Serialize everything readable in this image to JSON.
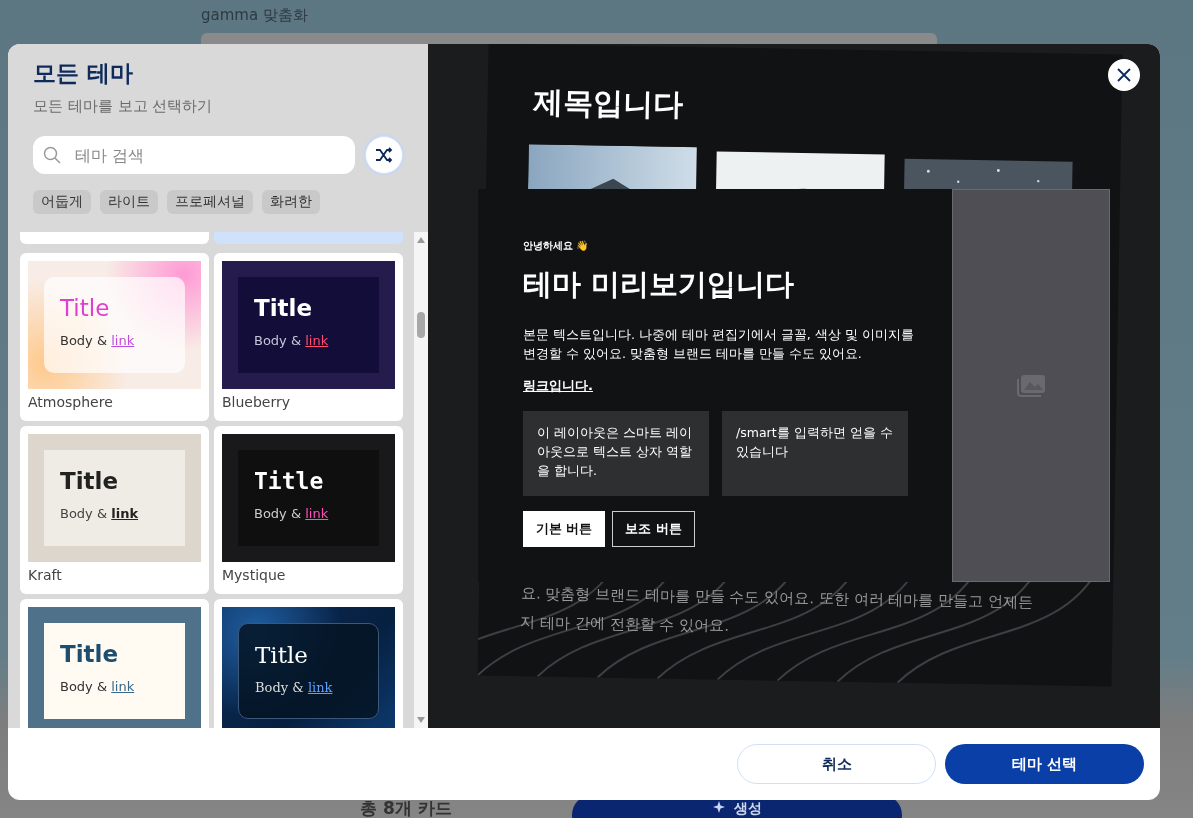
{
  "page": {
    "title": "gamma 맞춤화",
    "card_count": "총 8개 카드",
    "generate_button": "생성"
  },
  "dialog": {
    "title": "모든 테마",
    "subtitle": "모든 테마를 보고 선택하기",
    "search": {
      "placeholder": "테마 검색"
    },
    "filters": [
      {
        "label": "어둡게"
      },
      {
        "label": "라이트"
      },
      {
        "label": "프로페셔널"
      },
      {
        "label": "화려한"
      }
    ],
    "themes": [
      {
        "kind": "stub",
        "selected": false
      },
      {
        "kind": "stub",
        "selected": true
      },
      {
        "kind": "atmosphere",
        "name": "Atmosphere",
        "title": "Title",
        "body": "Body &",
        "link": "link",
        "selected": false
      },
      {
        "kind": "blueberry",
        "name": "Blueberry",
        "title": "Title",
        "body": "Body &",
        "link": "link",
        "selected": false
      },
      {
        "kind": "kraft",
        "name": "Kraft",
        "title": "Title",
        "body": "Body &",
        "link": "link",
        "selected": false
      },
      {
        "kind": "mystique",
        "name": "Mystique",
        "title": "Title",
        "body": "Body &",
        "link": "link",
        "selected": false
      },
      {
        "kind": "slate",
        "title": "Title",
        "body": "Body &",
        "link": "link",
        "selected": false
      },
      {
        "kind": "ocean",
        "title": "Title",
        "body": "Body &",
        "link": "link",
        "selected": false
      }
    ],
    "preview": {
      "back_title": "제목입니다",
      "back_lines": [
        "요. 맞춤형 브랜드 테마를 만들 수도 있어요. 또한 여러 테마를 만들고 언제든",
        "지 테마 간에 전환할 수 있어요."
      ],
      "eyebrow": "안녕하세요 👋",
      "heading": "테마 미리보기입니다",
      "body": "본문 텍스트입니다. 나중에 테마 편집기에서 글꼴, 색상 및 이미지를 변경할 수 있어요. 맞춤형 브랜드 테마를 만들 수도 있어요.",
      "link": "링크입니다.",
      "boxes": [
        "이 레이아웃은 스마트 레이아웃으로 텍스트 상자 역할을 합니다.",
        "/smart를 입력하면 얻을 수 있습니다"
      ],
      "primary_button": "기본 버튼",
      "secondary_button": "보조 버튼"
    },
    "cancel_button": "취소",
    "confirm_button": "테마 선택"
  }
}
